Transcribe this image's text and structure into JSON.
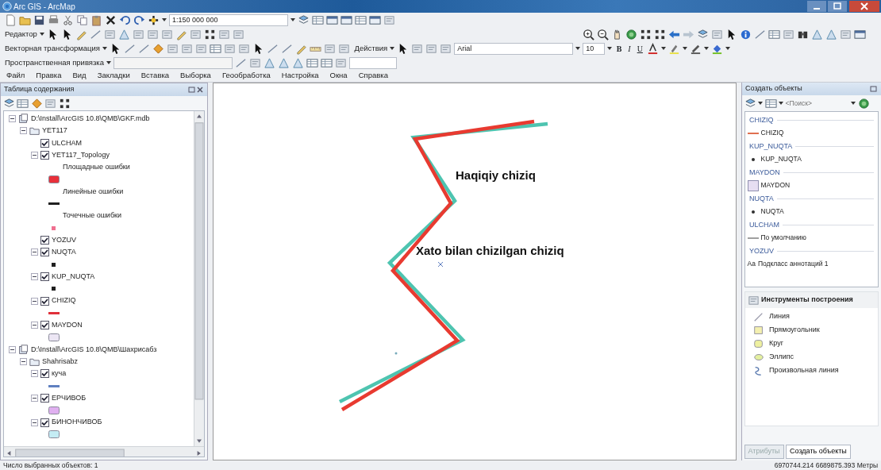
{
  "window": {
    "title": "Arc GIS - ArcMap"
  },
  "toolbars": {
    "scale": "1:150 000 000",
    "editor": "Редактор",
    "vector": "Векторная трансформация",
    "actions": "Действия",
    "font": "Arial",
    "font_size": "10",
    "format_buttons": [
      "B",
      "I",
      "U"
    ],
    "georef": "Пространственная привязка"
  },
  "menu": [
    "Файл",
    "Правка",
    "Вид",
    "Закладки",
    "Вставка",
    "Выборка",
    "Геообработка",
    "Настройка",
    "Окна",
    "Справка"
  ],
  "toc": {
    "title": "Таблица содержания",
    "tree": [
      {
        "kind": "database",
        "label": "D:\\Install\\ArcGIS 10.8\\QMB\\GKF.mdb",
        "expanded": true,
        "children": [
          {
            "kind": "dataset",
            "label": "YET117",
            "expanded": true,
            "children": [
              {
                "kind": "layer",
                "label": "ULCHAM",
                "checked": true
              },
              {
                "kind": "layer",
                "label": "YET117_Topology",
                "checked": true,
                "expanded": true,
                "legend": [
                  {
                    "label": "Площадные ошибки",
                    "kind": "polygon",
                    "color": "#e8303a"
                  },
                  {
                    "label": "Линейные ошибки",
                    "kind": "line",
                    "color": "#202020"
                  },
                  {
                    "label": "Точечные ошибки",
                    "kind": "point",
                    "color": "#f07090"
                  }
                ]
              },
              {
                "kind": "layer",
                "label": "YOZUV",
                "checked": true
              },
              {
                "kind": "layer",
                "label": "NUQTA",
                "checked": true,
                "expanded": true,
                "legend": [
                  {
                    "kind": "point",
                    "color": "#202020"
                  }
                ]
              },
              {
                "kind": "layer",
                "label": "KUP_NUQTA",
                "checked": true,
                "expanded": true,
                "legend": [
                  {
                    "kind": "point",
                    "color": "#202020"
                  }
                ]
              },
              {
                "kind": "layer",
                "label": "CHIZIQ",
                "checked": true,
                "expanded": true,
                "legend": [
                  {
                    "kind": "line",
                    "color": "#e0303a"
                  }
                ]
              },
              {
                "kind": "layer",
                "label": "MAYDON",
                "checked": true,
                "expanded": true,
                "legend": [
                  {
                    "kind": "polygon",
                    "color": "#ece6f4"
                  }
                ]
              }
            ]
          }
        ]
      },
      {
        "kind": "database",
        "label": "D:\\Install\\ArcGIS 10.8\\QMB\\Шахрисабз",
        "expanded": true,
        "children": [
          {
            "kind": "dataset",
            "label": "Shahrisabz",
            "expanded": true,
            "children": [
              {
                "kind": "layer",
                "label": "куча",
                "checked": true,
                "expanded": true,
                "legend": [
                  {
                    "kind": "line",
                    "color": "#6080c0"
                  }
                ]
              },
              {
                "kind": "layer",
                "label": "ЕРЧИВОБ",
                "checked": true,
                "expanded": true,
                "legend": [
                  {
                    "kind": "polygon",
                    "color": "#e0b0f0"
                  }
                ]
              },
              {
                "kind": "layer",
                "label": "БИНОНЧИВОБ",
                "checked": true,
                "expanded": true,
                "legend": [
                  {
                    "kind": "polygon",
                    "color": "#c4ecf4"
                  }
                ]
              }
            ]
          }
        ]
      }
    ]
  },
  "map": {
    "labels": [
      "Haqiqiy chiziq",
      "Xato bilan chizilgan chiziq"
    ]
  },
  "create_features": {
    "title": "Создать объекты",
    "search_placeholder": "<Поиск>",
    "groups": [
      {
        "layer": "CHIZIQ",
        "items": [
          {
            "label": "CHIZIQ",
            "kind": "line",
            "color": "#e07050"
          }
        ]
      },
      {
        "layer": "KUP_NUQTA",
        "items": [
          {
            "label": "KUP_NUQTA",
            "kind": "point",
            "color": "#303030"
          }
        ]
      },
      {
        "layer": "MAYDON",
        "items": [
          {
            "label": "MAYDON",
            "kind": "polygon",
            "color": "#e6def2"
          }
        ]
      },
      {
        "layer": "NUQTA",
        "items": [
          {
            "label": "NUQTA",
            "kind": "point",
            "color": "#303030"
          }
        ]
      },
      {
        "layer": "ULCHAM",
        "items": [
          {
            "label": "По умолчанию",
            "kind": "line",
            "color": "#a0a0a0"
          }
        ]
      },
      {
        "layer": "YOZUV",
        "items": [
          {
            "label": "Подкласс аннотаций 1",
            "kind": "annotation",
            "glyph": "Aa"
          }
        ]
      }
    ],
    "tools_title": "Инструменты построения",
    "tools": [
      {
        "label": "Линия",
        "kind": "line"
      },
      {
        "label": "Прямоугольник",
        "kind": "rectangle"
      },
      {
        "label": "Круг",
        "kind": "circle"
      },
      {
        "label": "Эллипс",
        "kind": "ellipse"
      },
      {
        "label": "Произвольная линия",
        "kind": "freehand"
      }
    ],
    "tabs": [
      {
        "label": "Атрибуты",
        "selected": false
      },
      {
        "label": "Создать объекты",
        "selected": true
      }
    ]
  },
  "status_bar": {
    "selection": "Число выбранных объектов: 1",
    "coordinates": "6970744.214  6689875.393 Метры"
  }
}
